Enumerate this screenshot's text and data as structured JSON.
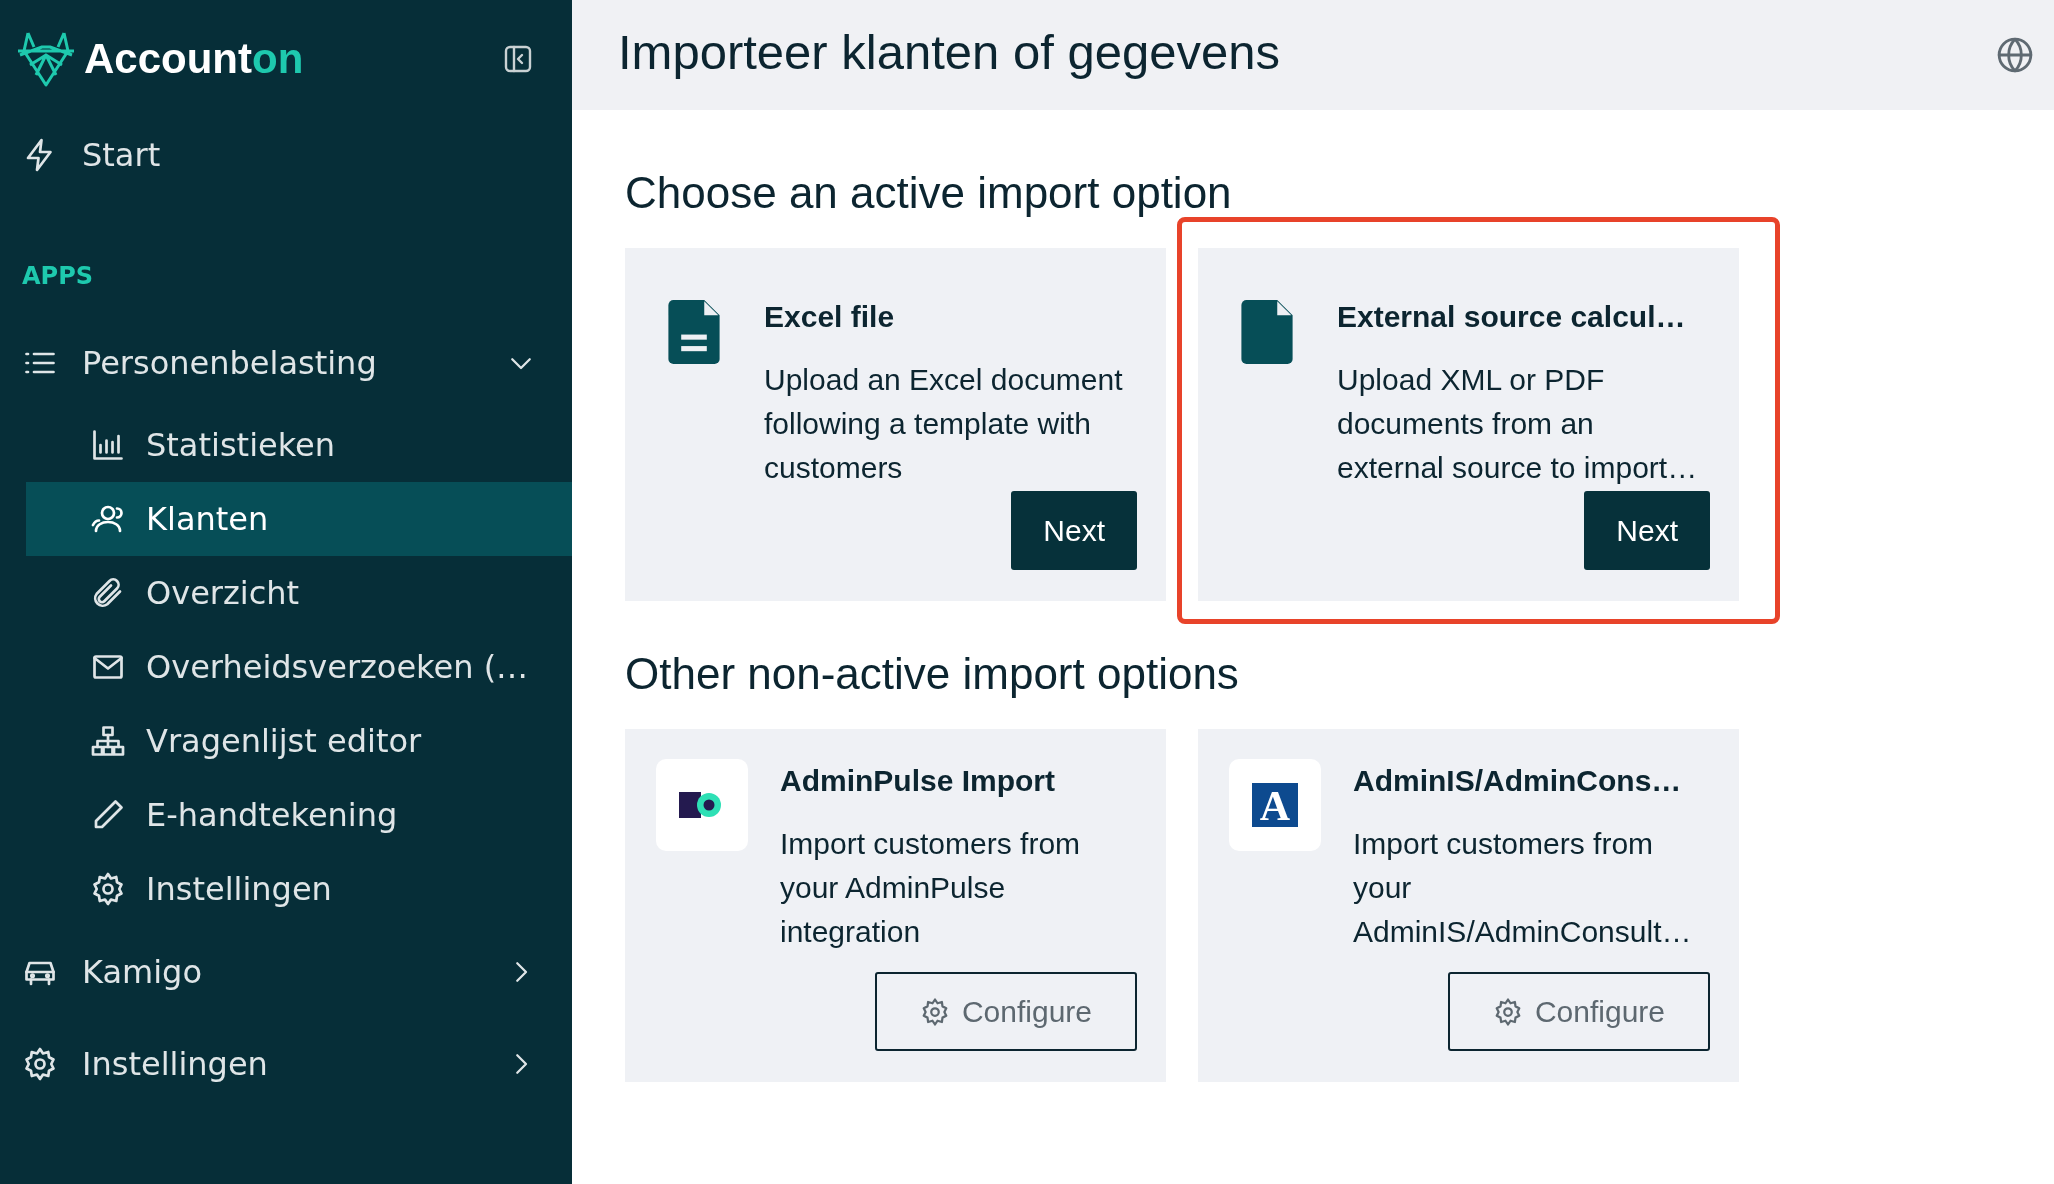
{
  "sidebar": {
    "brand": [
      "Account",
      "on"
    ],
    "items": [
      {
        "kind": "link",
        "label": "Start"
      },
      {
        "kind": "section",
        "label": "APPS"
      },
      {
        "kind": "group",
        "label": "Personenbelasting",
        "expanded": true,
        "children": [
          {
            "label": "Statistieken",
            "selected": false
          },
          {
            "label": "Klanten",
            "selected": true
          },
          {
            "label": "Overzicht",
            "selected": false
          },
          {
            "label": "Overheidsverzoeken (…",
            "selected": false
          },
          {
            "label": "Vragenlijst editor",
            "selected": false
          },
          {
            "label": "E-handtekening",
            "selected": false
          },
          {
            "label": "Instellingen",
            "selected": false
          }
        ]
      },
      {
        "kind": "group",
        "label": "Kamigo",
        "expanded": false
      },
      {
        "kind": "group",
        "label": "Instellingen",
        "expanded": false
      }
    ]
  },
  "header": {
    "title": "Importeer klanten of gegevens"
  },
  "sections": [
    {
      "heading": "Choose an active import option",
      "options": [
        {
          "kind": "file",
          "title": "Excel file",
          "description": "Upload an Excel document following a template with customers",
          "button": "Next",
          "highlighted": false
        },
        {
          "kind": "file",
          "title": "External source calcul…",
          "description": "Upload XML or PDF documents from an external source to import…",
          "button": "Next",
          "highlighted": true
        }
      ]
    },
    {
      "heading": "Other non-active import options",
      "options": [
        {
          "kind": "integration",
          "title": "AdminPulse Import",
          "description": "Import customers from your AdminPulse integration",
          "button": "Configure",
          "highlighted": false
        },
        {
          "kind": "integration",
          "logo_letter": "A",
          "title": "AdminIS/AdminCons…",
          "description": "Import customers from your AdminIS/AdminConsult…",
          "button": "Configure",
          "highlighted": false
        }
      ]
    }
  ]
}
